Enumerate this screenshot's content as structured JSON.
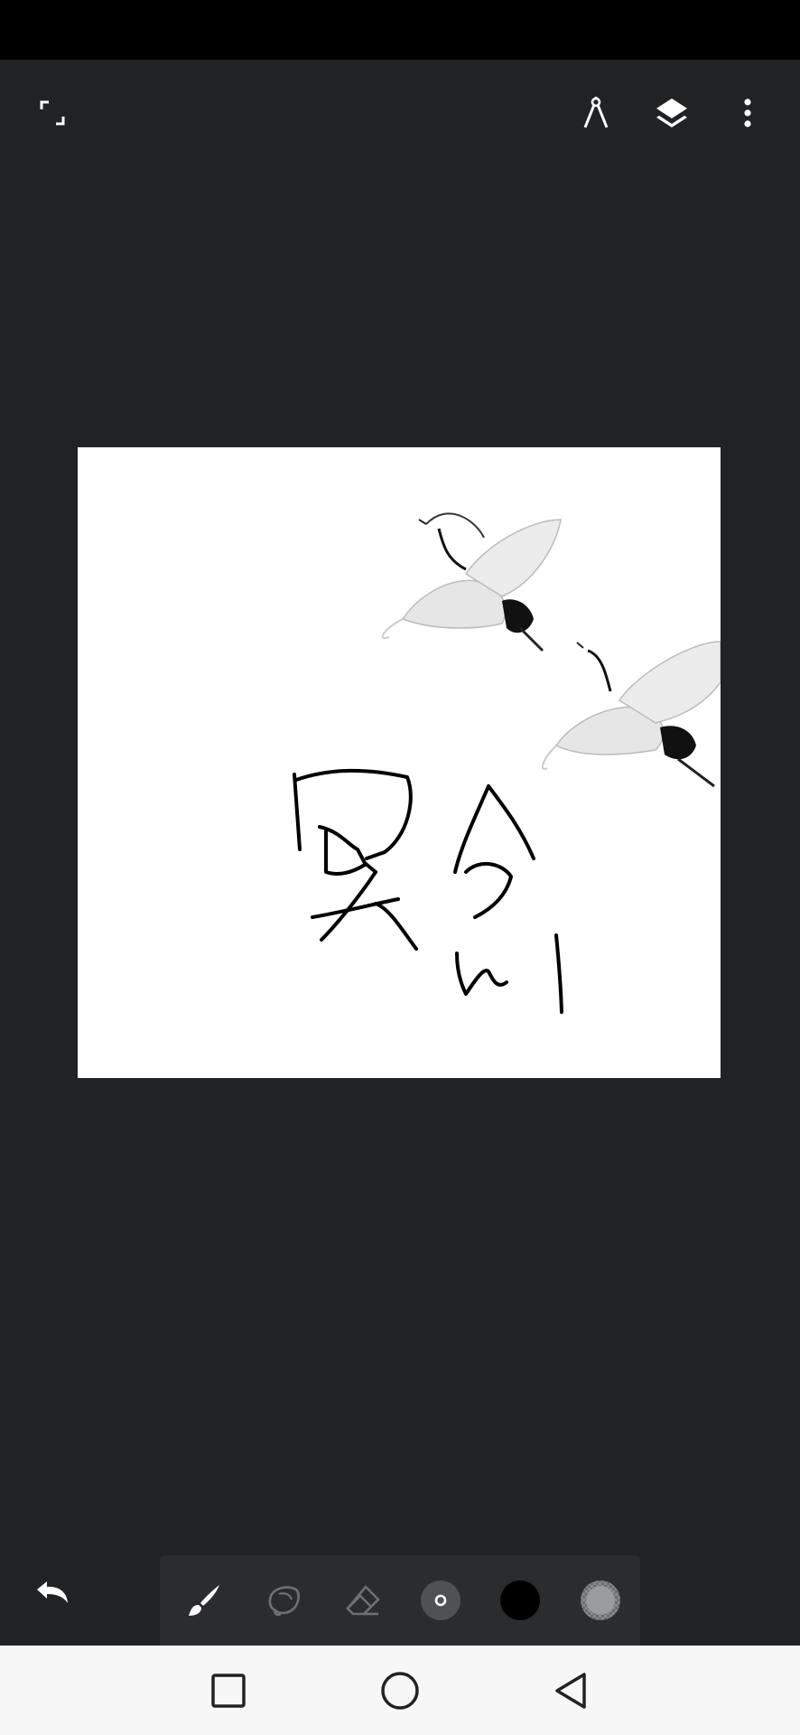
{
  "icons": {
    "fullscreen": "fullscreen-icon",
    "ruler": "compass-ruler-icon",
    "layers": "layers-icon",
    "more": "more-vertical-icon",
    "undo": "undo-icon",
    "brush": "brush-icon",
    "lasso": "lasso-icon",
    "eraser": "eraser-icon",
    "brush_size": "brush-size-icon",
    "color": "color-swatch-icon",
    "opacity": "opacity-icon",
    "recents": "square-icon",
    "home": "circle-icon",
    "back": "triangle-back-icon"
  },
  "colors": {
    "app_background": "#212224",
    "status_bar": "#000000",
    "toolbar_background": "#2b2c2e",
    "canvas_background": "#ffffff",
    "current_color": "#000000",
    "navbar_background": "#f7f7f7"
  },
  "tools": {
    "active": "brush",
    "current_color": "#000000"
  }
}
